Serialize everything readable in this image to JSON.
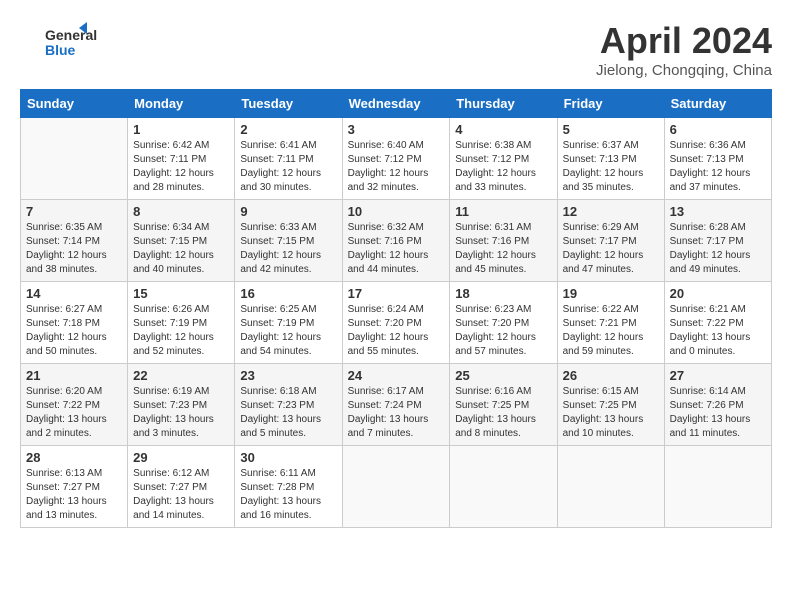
{
  "header": {
    "logo_general": "General",
    "logo_blue": "Blue",
    "month": "April 2024",
    "location": "Jielong, Chongqing, China"
  },
  "days_of_week": [
    "Sunday",
    "Monday",
    "Tuesday",
    "Wednesday",
    "Thursday",
    "Friday",
    "Saturday"
  ],
  "weeks": [
    [
      {
        "num": "",
        "info": ""
      },
      {
        "num": "1",
        "info": "Sunrise: 6:42 AM\nSunset: 7:11 PM\nDaylight: 12 hours\nand 28 minutes."
      },
      {
        "num": "2",
        "info": "Sunrise: 6:41 AM\nSunset: 7:11 PM\nDaylight: 12 hours\nand 30 minutes."
      },
      {
        "num": "3",
        "info": "Sunrise: 6:40 AM\nSunset: 7:12 PM\nDaylight: 12 hours\nand 32 minutes."
      },
      {
        "num": "4",
        "info": "Sunrise: 6:38 AM\nSunset: 7:12 PM\nDaylight: 12 hours\nand 33 minutes."
      },
      {
        "num": "5",
        "info": "Sunrise: 6:37 AM\nSunset: 7:13 PM\nDaylight: 12 hours\nand 35 minutes."
      },
      {
        "num": "6",
        "info": "Sunrise: 6:36 AM\nSunset: 7:13 PM\nDaylight: 12 hours\nand 37 minutes."
      }
    ],
    [
      {
        "num": "7",
        "info": "Sunrise: 6:35 AM\nSunset: 7:14 PM\nDaylight: 12 hours\nand 38 minutes."
      },
      {
        "num": "8",
        "info": "Sunrise: 6:34 AM\nSunset: 7:15 PM\nDaylight: 12 hours\nand 40 minutes."
      },
      {
        "num": "9",
        "info": "Sunrise: 6:33 AM\nSunset: 7:15 PM\nDaylight: 12 hours\nand 42 minutes."
      },
      {
        "num": "10",
        "info": "Sunrise: 6:32 AM\nSunset: 7:16 PM\nDaylight: 12 hours\nand 44 minutes."
      },
      {
        "num": "11",
        "info": "Sunrise: 6:31 AM\nSunset: 7:16 PM\nDaylight: 12 hours\nand 45 minutes."
      },
      {
        "num": "12",
        "info": "Sunrise: 6:29 AM\nSunset: 7:17 PM\nDaylight: 12 hours\nand 47 minutes."
      },
      {
        "num": "13",
        "info": "Sunrise: 6:28 AM\nSunset: 7:17 PM\nDaylight: 12 hours\nand 49 minutes."
      }
    ],
    [
      {
        "num": "14",
        "info": "Sunrise: 6:27 AM\nSunset: 7:18 PM\nDaylight: 12 hours\nand 50 minutes."
      },
      {
        "num": "15",
        "info": "Sunrise: 6:26 AM\nSunset: 7:19 PM\nDaylight: 12 hours\nand 52 minutes."
      },
      {
        "num": "16",
        "info": "Sunrise: 6:25 AM\nSunset: 7:19 PM\nDaylight: 12 hours\nand 54 minutes."
      },
      {
        "num": "17",
        "info": "Sunrise: 6:24 AM\nSunset: 7:20 PM\nDaylight: 12 hours\nand 55 minutes."
      },
      {
        "num": "18",
        "info": "Sunrise: 6:23 AM\nSunset: 7:20 PM\nDaylight: 12 hours\nand 57 minutes."
      },
      {
        "num": "19",
        "info": "Sunrise: 6:22 AM\nSunset: 7:21 PM\nDaylight: 12 hours\nand 59 minutes."
      },
      {
        "num": "20",
        "info": "Sunrise: 6:21 AM\nSunset: 7:22 PM\nDaylight: 13 hours\nand 0 minutes."
      }
    ],
    [
      {
        "num": "21",
        "info": "Sunrise: 6:20 AM\nSunset: 7:22 PM\nDaylight: 13 hours\nand 2 minutes."
      },
      {
        "num": "22",
        "info": "Sunrise: 6:19 AM\nSunset: 7:23 PM\nDaylight: 13 hours\nand 3 minutes."
      },
      {
        "num": "23",
        "info": "Sunrise: 6:18 AM\nSunset: 7:23 PM\nDaylight: 13 hours\nand 5 minutes."
      },
      {
        "num": "24",
        "info": "Sunrise: 6:17 AM\nSunset: 7:24 PM\nDaylight: 13 hours\nand 7 minutes."
      },
      {
        "num": "25",
        "info": "Sunrise: 6:16 AM\nSunset: 7:25 PM\nDaylight: 13 hours\nand 8 minutes."
      },
      {
        "num": "26",
        "info": "Sunrise: 6:15 AM\nSunset: 7:25 PM\nDaylight: 13 hours\nand 10 minutes."
      },
      {
        "num": "27",
        "info": "Sunrise: 6:14 AM\nSunset: 7:26 PM\nDaylight: 13 hours\nand 11 minutes."
      }
    ],
    [
      {
        "num": "28",
        "info": "Sunrise: 6:13 AM\nSunset: 7:27 PM\nDaylight: 13 hours\nand 13 minutes."
      },
      {
        "num": "29",
        "info": "Sunrise: 6:12 AM\nSunset: 7:27 PM\nDaylight: 13 hours\nand 14 minutes."
      },
      {
        "num": "30",
        "info": "Sunrise: 6:11 AM\nSunset: 7:28 PM\nDaylight: 13 hours\nand 16 minutes."
      },
      {
        "num": "",
        "info": ""
      },
      {
        "num": "",
        "info": ""
      },
      {
        "num": "",
        "info": ""
      },
      {
        "num": "",
        "info": ""
      }
    ]
  ]
}
